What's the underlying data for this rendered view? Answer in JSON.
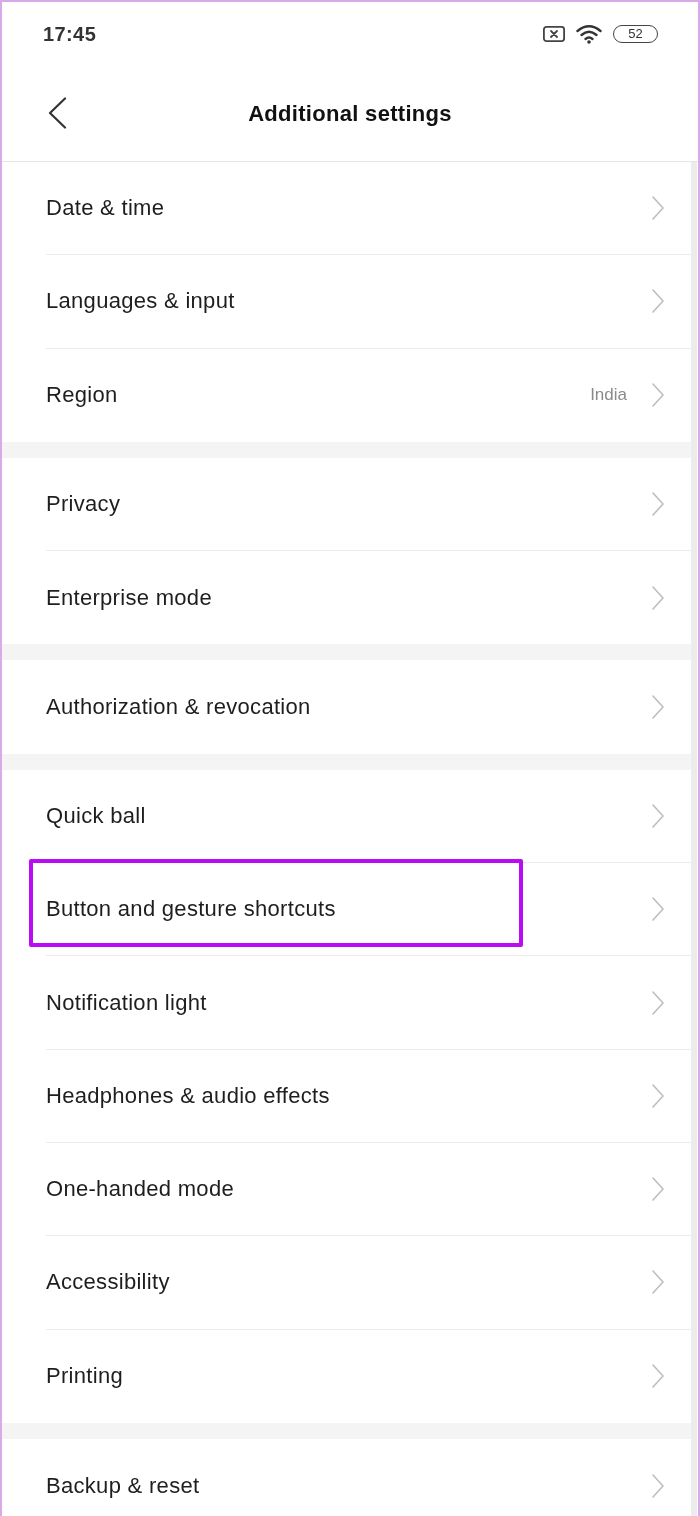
{
  "status_bar": {
    "time": "17:45",
    "battery": "52"
  },
  "header": {
    "title": "Additional settings"
  },
  "groups": [
    {
      "items": [
        {
          "label": "Date & time",
          "highlighted": false
        },
        {
          "label": "Languages & input",
          "highlighted": false
        },
        {
          "label": "Region",
          "value": "India",
          "highlighted": false
        }
      ]
    },
    {
      "items": [
        {
          "label": "Privacy",
          "highlighted": false
        },
        {
          "label": "Enterprise mode",
          "highlighted": false
        }
      ]
    },
    {
      "items": [
        {
          "label": "Authorization & revocation",
          "highlighted": false
        }
      ]
    },
    {
      "items": [
        {
          "label": "Quick ball",
          "highlighted": false
        },
        {
          "label": "Button and gesture shortcuts",
          "highlighted": true
        },
        {
          "label": "Notification light",
          "highlighted": false
        },
        {
          "label": "Headphones & audio effects",
          "highlighted": false
        },
        {
          "label": "One-handed mode",
          "highlighted": false
        },
        {
          "label": "Accessibility",
          "highlighted": false
        },
        {
          "label": "Printing",
          "highlighted": false
        }
      ]
    },
    {
      "items": [
        {
          "label": "Backup & reset",
          "highlighted": false
        }
      ]
    }
  ]
}
